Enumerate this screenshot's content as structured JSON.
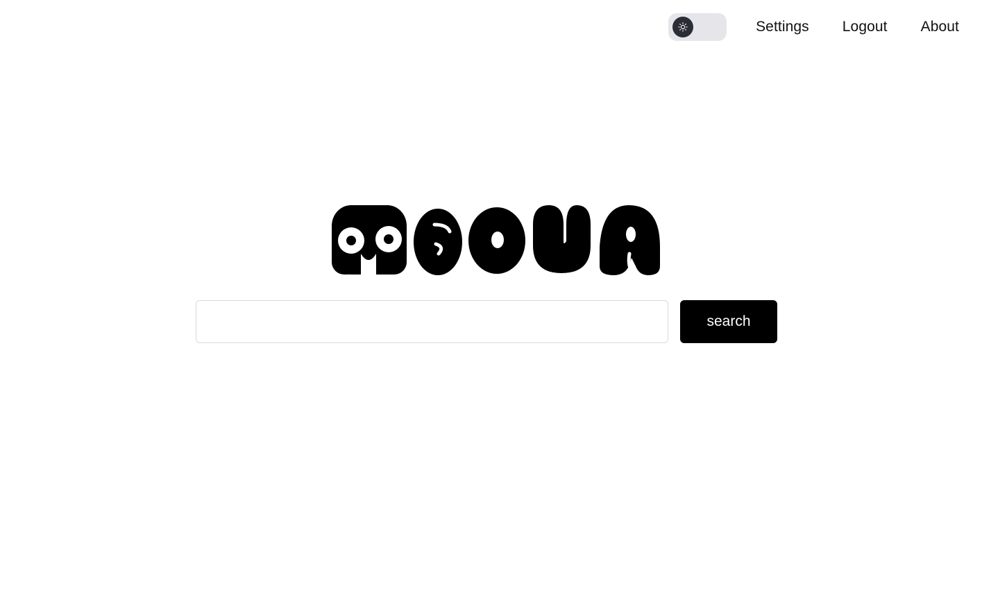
{
  "nav": {
    "theme_toggle": {
      "icon": "sun-icon",
      "state": "light"
    },
    "links": [
      {
        "label": "Settings"
      },
      {
        "label": "Logout"
      },
      {
        "label": "About"
      }
    ]
  },
  "logo": {
    "text": "MEOVA"
  },
  "search": {
    "value": "",
    "placeholder": "",
    "button_label": "search"
  },
  "colors": {
    "background": "#ffffff",
    "button": "#000000",
    "button_text": "#ffffff",
    "toggle_track": "#e6e6ea",
    "toggle_knob": "#2b2e36"
  }
}
